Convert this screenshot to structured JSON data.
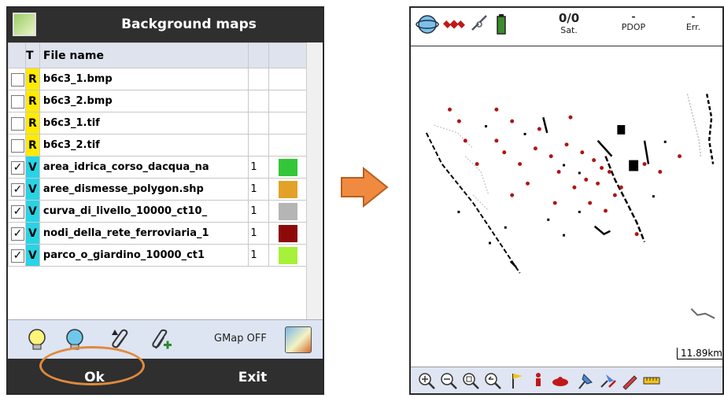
{
  "left": {
    "title": "Background maps",
    "columns": {
      "type": "T",
      "filename": "File name"
    },
    "rows": [
      {
        "checked": false,
        "type": "R",
        "filename": "b6c3_1.bmp",
        "num": "",
        "color": ""
      },
      {
        "checked": false,
        "type": "R",
        "filename": "b6c3_2.bmp",
        "num": "",
        "color": ""
      },
      {
        "checked": false,
        "type": "R",
        "filename": "b6c3_1.tif",
        "num": "",
        "color": ""
      },
      {
        "checked": false,
        "type": "R",
        "filename": "b6c3_2.tif",
        "num": "",
        "color": ""
      },
      {
        "checked": true,
        "type": "V",
        "filename": "area_idrica_corso_dacqua_na",
        "num": "1",
        "color": "#34c63a"
      },
      {
        "checked": true,
        "type": "V",
        "filename": "aree_dismesse_polygon.shp",
        "num": "1",
        "color": "#e2a227"
      },
      {
        "checked": true,
        "type": "V",
        "filename": "curva_di_livello_10000_ct10_",
        "num": "1",
        "color": "#b5b5b5"
      },
      {
        "checked": true,
        "type": "V",
        "filename": "nodi_della_rete_ferroviaria_1",
        "num": "1",
        "color": "#8e0a0a"
      },
      {
        "checked": true,
        "type": "V",
        "filename": "parco_o_giardino_10000_ct1",
        "num": "1",
        "color": "#a8f13a"
      }
    ],
    "toolbar": {
      "gmap_label": "GMap OFF"
    },
    "buttons": {
      "ok": "Ok",
      "exit": "Exit"
    }
  },
  "right": {
    "status": {
      "sat_value": "0/0",
      "sat_label": "Sat.",
      "pdop_value": "-",
      "pdop_label": "PDOP",
      "err_value": "-",
      "err_label": "Err."
    },
    "scale_text": "11.89km"
  },
  "colors": {
    "bar_dark": "#2f2f2f",
    "header_bg": "#dfe3ee",
    "type_r": "#ffea00",
    "type_v": "#29d3e6",
    "highlight": "#e08a3c"
  }
}
